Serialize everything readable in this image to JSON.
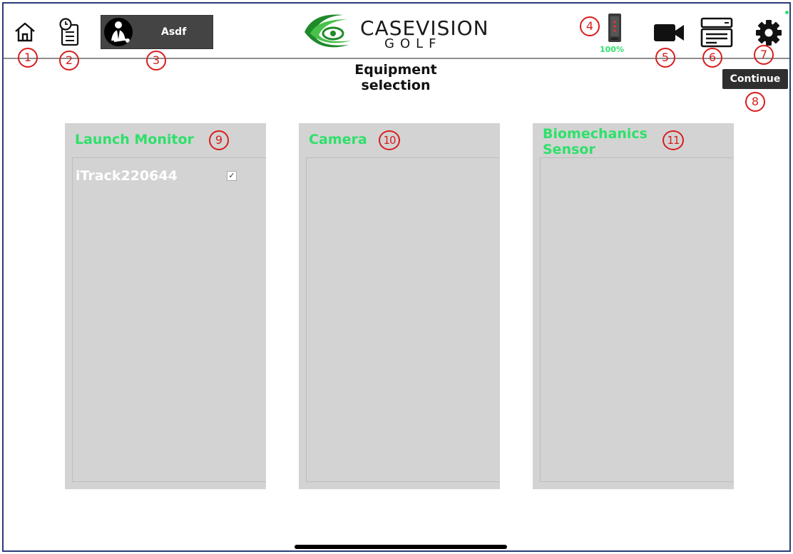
{
  "header": {
    "user": {
      "name": "Asdf"
    },
    "logo": {
      "main": "CASEVISION",
      "sub": "GOLF"
    },
    "battery": "100%",
    "continue_label": "Continue"
  },
  "page": {
    "title_line1": "Equipment",
    "title_line2": "selection"
  },
  "panels": [
    {
      "title": "Launch Monitor",
      "devices": [
        {
          "name": "iTrack220644",
          "checked": true
        }
      ]
    },
    {
      "title": "Camera",
      "devices": []
    },
    {
      "title_line1": "Biomechanics",
      "title_line2": "Sensor",
      "devices": []
    }
  ],
  "callouts": [
    "1",
    "2",
    "3",
    "4",
    "5",
    "6",
    "7",
    "8",
    "9",
    "10",
    "11"
  ],
  "icons": {
    "home": "home-icon",
    "history": "history-list-icon",
    "device": "launch-monitor-device-icon",
    "camera": "video-camera-icon",
    "server": "server-icon",
    "settings": "gear-icon",
    "check": "checkmark-icon"
  },
  "colors": {
    "accent_green": "#2ee06a",
    "callout_red": "#d81e1e",
    "panel_bg": "#d3d3d3",
    "dark_button": "#2f2f2f"
  }
}
